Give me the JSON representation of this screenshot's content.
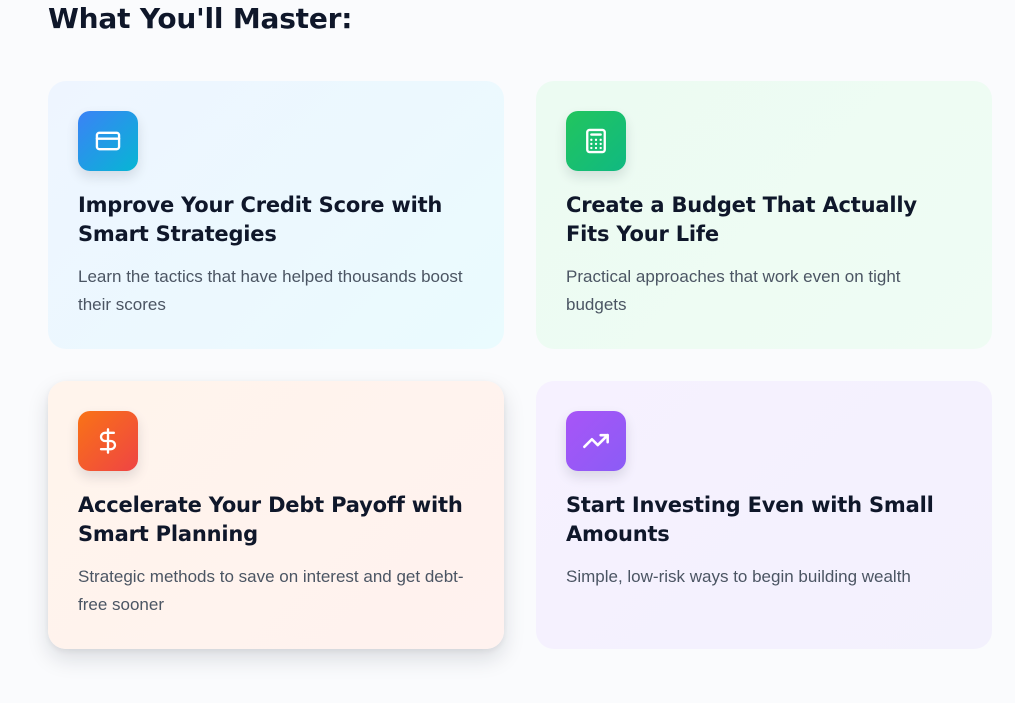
{
  "section": {
    "title": "What You'll Master:"
  },
  "cards": [
    {
      "icon": "credit-card-icon",
      "accent": "#3b82f6",
      "title": "Improve Your Credit Score with Smart Strategies",
      "description": "Learn the tactics that have helped thousands boost their scores"
    },
    {
      "icon": "calculator-icon",
      "accent": "#22c55e",
      "title": "Create a Budget That Actually Fits Your Life",
      "description": "Practical approaches that work even on tight budgets"
    },
    {
      "icon": "dollar-sign-icon",
      "accent": "#f97316",
      "title": "Accelerate Your Debt Payoff with Smart Planning",
      "description": "Strategic methods to save on interest and get debt-free sooner"
    },
    {
      "icon": "trending-up-icon",
      "accent": "#a855f7",
      "title": "Start Investing Even with Small Amounts",
      "description": "Simple, low-risk ways to begin building wealth"
    }
  ]
}
